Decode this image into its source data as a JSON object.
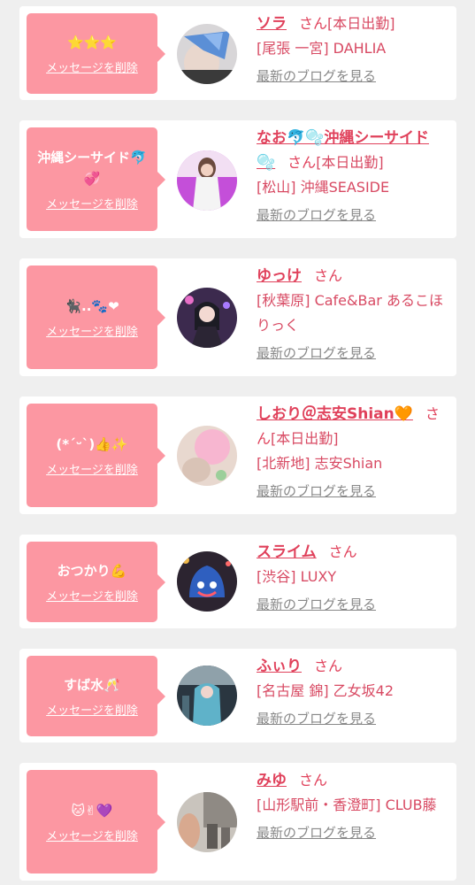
{
  "common": {
    "delete_label": "メッセージを削除",
    "blog_label": "最新のブログを見る",
    "san": "さん",
    "colors": {
      "pink_bubble": "#fc97a2",
      "name_red": "#e0415b",
      "background": "#efefef"
    }
  },
  "items": [
    {
      "message": "⭐⭐⭐",
      "name": "ソラ",
      "status": "[本日出勤]",
      "shop": "[尾張 一宮] DAHLIA",
      "avatar": "avatar-photo-blue-mask"
    },
    {
      "message": "沖縄シーサイド🐬💞",
      "name": "なお🐬🫧沖縄シーサイド🫧",
      "status": "[本日出勤]",
      "shop": "[松山] 沖縄SEASIDE",
      "avatar": "avatar-photo-white-dress"
    },
    {
      "message": "🐈‍⬛..🐾❤",
      "name": "ゆっけ",
      "status": "",
      "shop": "[秋葉原] Cafe&Bar あるこほりっく",
      "avatar": "avatar-photo-purple-costume"
    },
    {
      "message": "(*ˊᵕˋ)👍✨",
      "name": "しおり＠志安Shian🧡",
      "status": "[本日出勤]",
      "shop": "[北新地] 志安Shian",
      "avatar": "avatar-photo-blurred"
    },
    {
      "message": "おつかり💪",
      "name": "スライム",
      "status": "",
      "shop": "[渋谷] LUXY",
      "avatar": "avatar-photo-slime"
    },
    {
      "message": "すば水🥂",
      "name": "ふぃり",
      "status": "",
      "shop": "[名古屋 錦] 乙女坂42",
      "avatar": "avatar-photo-blue-hair"
    },
    {
      "message": "🐱✌💜",
      "name": "みゆ",
      "status": "",
      "shop": "[山形駅前・香澄町] CLUB藤",
      "avatar": "avatar-photo-street"
    }
  ]
}
